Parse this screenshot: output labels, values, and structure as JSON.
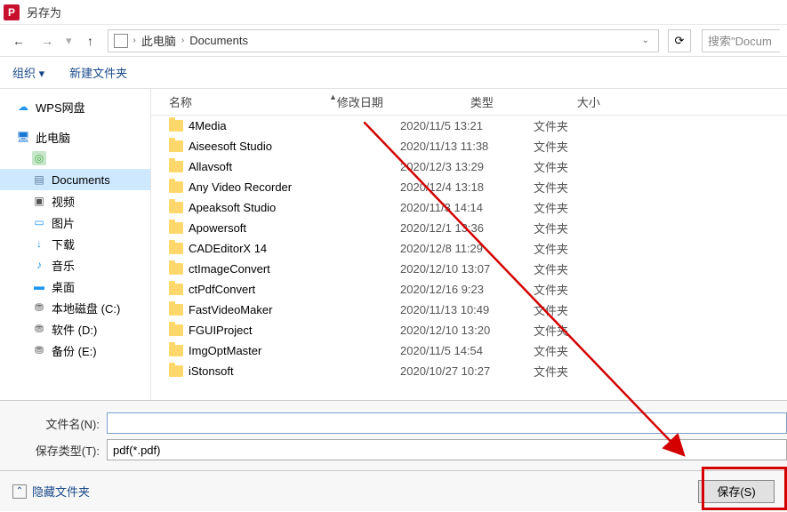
{
  "window": {
    "title": "另存为",
    "app_icon_letter": "P"
  },
  "nav": {
    "back": "←",
    "fwd": "→",
    "up": "↑",
    "crumbs": [
      "此电脑",
      "Documents"
    ],
    "search_placeholder": "搜索\"Docum"
  },
  "toolbar": {
    "organize": "组织 ▾",
    "new_folder": "新建文件夹"
  },
  "sidebar": [
    {
      "icon": "cloud",
      "label": "WPS网盘",
      "level": 1
    },
    {
      "icon": "",
      "label": "",
      "level": 0,
      "spacer": true
    },
    {
      "icon": "pc",
      "label": "此电脑",
      "level": 1
    },
    {
      "icon": "green",
      "label": "",
      "level": 2
    },
    {
      "icon": "docs",
      "label": "Documents",
      "level": 2,
      "selected": true
    },
    {
      "icon": "video",
      "label": "视频",
      "level": 2
    },
    {
      "icon": "pic",
      "label": "图片",
      "level": 2
    },
    {
      "icon": "down",
      "label": "下载",
      "level": 2
    },
    {
      "icon": "music",
      "label": "音乐",
      "level": 2
    },
    {
      "icon": "desk",
      "label": "桌面",
      "level": 2
    },
    {
      "icon": "disk",
      "label": "本地磁盘 (C:)",
      "level": 2
    },
    {
      "icon": "disk",
      "label": "软件 (D:)",
      "level": 2
    },
    {
      "icon": "disk",
      "label": "备份 (E:)",
      "level": 2
    }
  ],
  "columns": {
    "name": "名称",
    "date": "修改日期",
    "type": "类型",
    "size": "大小"
  },
  "files": [
    {
      "name": "4Media",
      "date": "2020/11/5 13:21",
      "type": "文件夹"
    },
    {
      "name": "Aiseesoft Studio",
      "date": "2020/11/13 11:38",
      "type": "文件夹"
    },
    {
      "name": "Allavsoft",
      "date": "2020/12/3 13:29",
      "type": "文件夹"
    },
    {
      "name": "Any Video Recorder",
      "date": "2020/12/4 13:18",
      "type": "文件夹"
    },
    {
      "name": "Apeaksoft Studio",
      "date": "2020/11/3 14:14",
      "type": "文件夹"
    },
    {
      "name": "Apowersoft",
      "date": "2020/12/1 13:36",
      "type": "文件夹"
    },
    {
      "name": "CADEditorX 14",
      "date": "2020/12/8 11:29",
      "type": "文件夹"
    },
    {
      "name": "ctImageConvert",
      "date": "2020/12/10 13:07",
      "type": "文件夹"
    },
    {
      "name": "ctPdfConvert",
      "date": "2020/12/16 9:23",
      "type": "文件夹"
    },
    {
      "name": "FastVideoMaker",
      "date": "2020/11/13 10:49",
      "type": "文件夹"
    },
    {
      "name": "FGUIProject",
      "date": "2020/12/10 13:20",
      "type": "文件夹"
    },
    {
      "name": "ImgOptMaster",
      "date": "2020/11/5 14:54",
      "type": "文件夹"
    },
    {
      "name": "iStonsoft",
      "date": "2020/10/27 10:27",
      "type": "文件夹"
    }
  ],
  "filename": {
    "label": "文件名(N):",
    "value": ""
  },
  "filetype": {
    "label": "保存类型(T):",
    "value": "pdf(*.pdf)"
  },
  "footer": {
    "hide_folders": "隐藏文件夹",
    "save": "保存(S)"
  }
}
